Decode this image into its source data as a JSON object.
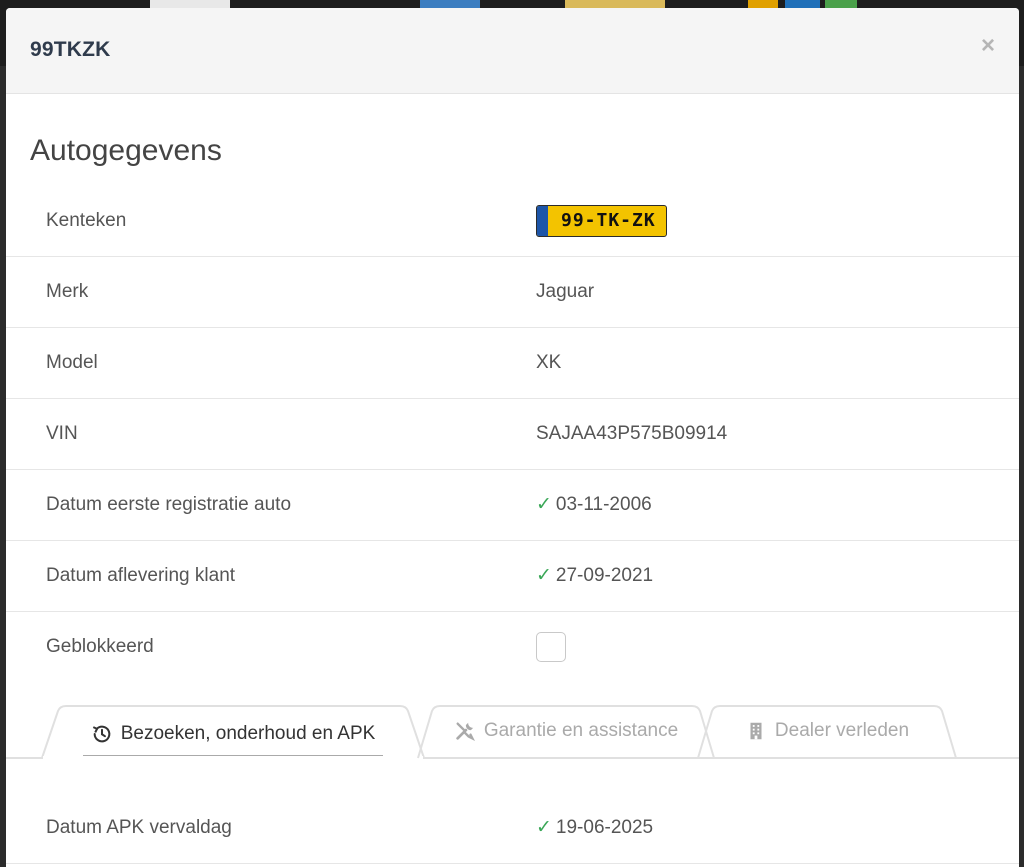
{
  "modal": {
    "title": "99TKZK",
    "close_label": "×",
    "section_title": "Autogegevens"
  },
  "vehicle": {
    "rows": [
      {
        "label": "Kenteken",
        "value": "99-TK-ZK",
        "type": "plate"
      },
      {
        "label": "Merk",
        "value": "Jaguar",
        "type": "text"
      },
      {
        "label": "Model",
        "value": "XK",
        "type": "text"
      },
      {
        "label": "VIN",
        "value": "SAJAA43P575B09914",
        "type": "text"
      },
      {
        "label": "Datum eerste registratie auto",
        "value": "03-11-2006",
        "type": "checked"
      },
      {
        "label": "Datum aflevering klant",
        "value": "27-09-2021",
        "type": "checked"
      },
      {
        "label": "Geblokkeerd",
        "value": "",
        "type": "checkbox"
      }
    ]
  },
  "tabs": [
    {
      "label": "Bezoeken, onderhoud en APK",
      "icon": "history-icon",
      "active": true
    },
    {
      "label": "Garantie en assistance",
      "icon": "tools-icon",
      "active": false
    },
    {
      "label": "Dealer verleden",
      "icon": "building-icon",
      "active": false
    }
  ],
  "apk": {
    "label": "Datum APK vervaldag",
    "value": "19-06-2025"
  },
  "colors": {
    "check": "#3aa757",
    "plate_yellow": "#f3c300",
    "plate_blue": "#1d55a8"
  }
}
